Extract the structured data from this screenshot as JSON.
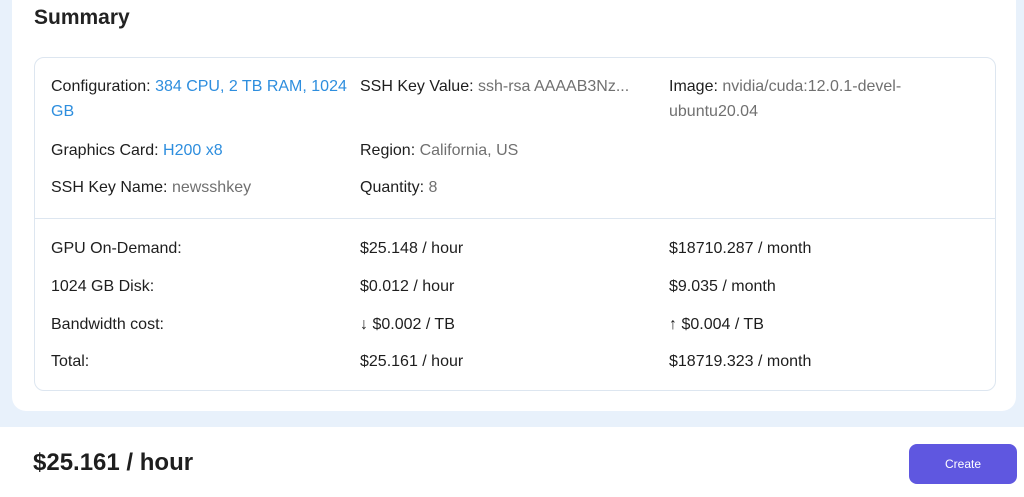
{
  "summary": {
    "title": "Summary",
    "config": {
      "configuration_label": "Configuration: ",
      "configuration_value": "384 CPU, 2 TB RAM, 1024 GB",
      "ssh_value_label": "SSH Key Value: ",
      "ssh_value_value": "ssh-rsa AAAAB3Nz...",
      "image_label": "Image: ",
      "image_value": "nvidia/cuda:12.0.1-devel-ubuntu20.04",
      "graphics_label": "Graphics Card: ",
      "graphics_value": "H200 x8",
      "region_label": "Region: ",
      "region_value": "California, US",
      "ssh_name_label": "SSH Key Name: ",
      "ssh_name_value": "newsshkey",
      "quantity_label": "Quantity: ",
      "quantity_value": "8"
    },
    "costs": [
      {
        "label": "GPU On-Demand:",
        "hour": "$25.148 / hour",
        "month": "$18710.287 / month"
      },
      {
        "label": "1024 GB Disk:",
        "hour": "$0.012 / hour",
        "month": "$9.035 / month"
      },
      {
        "label": "Bandwidth cost:",
        "hour": "↓ $0.002 / TB",
        "month": "↑ $0.004 / TB"
      },
      {
        "label": "Total:",
        "hour": "$25.161 / hour",
        "month": "$18719.323 / month"
      }
    ]
  },
  "footer": {
    "price": "$25.161 / hour",
    "create_label": "Create"
  },
  "colors": {
    "accent_link": "#2e8ede",
    "button": "#5f57e0"
  }
}
